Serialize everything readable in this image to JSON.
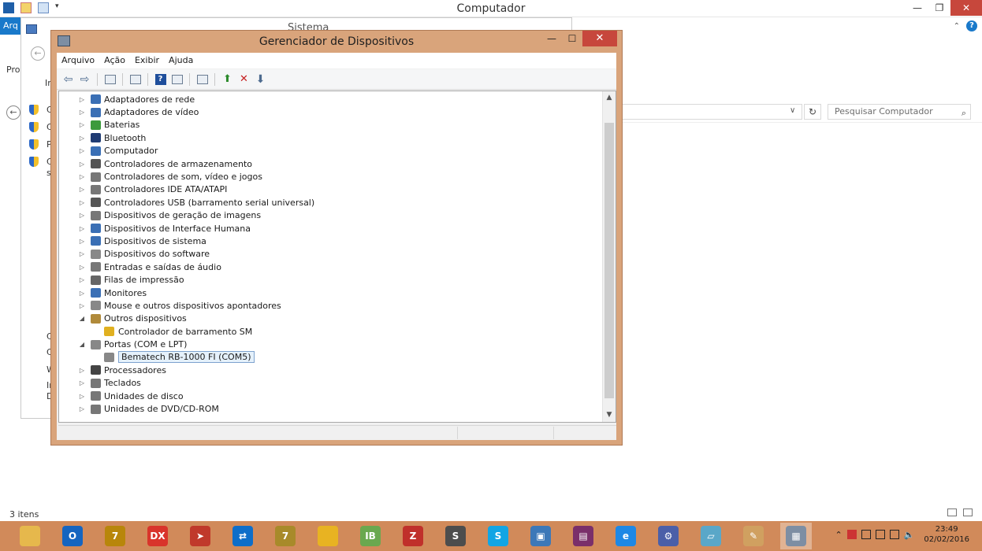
{
  "explorer": {
    "title": "Computador",
    "ribbon_file": "Arq",
    "search_placeholder": "Pesquisar Computador",
    "status": "3 itens",
    "left_labels": [
      "Pro",
      "In"
    ]
  },
  "system_window": {
    "title": "Sistema",
    "sidebar_letters": [
      "G",
      "C",
      "P",
      "C",
      "si"
    ],
    "lower_letters": [
      "C",
      "C",
      "W",
      "In",
      "D"
    ]
  },
  "device_manager": {
    "title": "Gerenciador de Dispositivos",
    "menu": [
      "Arquivo",
      "Ação",
      "Exibir",
      "Ajuda"
    ],
    "tree": [
      {
        "label": "Adaptadores de rede",
        "level": 0,
        "expander": "▷",
        "icon": "network-adapter-icon",
        "color": "#3a6fb5"
      },
      {
        "label": "Adaptadores de vídeo",
        "level": 0,
        "expander": "▷",
        "icon": "display-adapter-icon",
        "color": "#3a6fb5"
      },
      {
        "label": "Baterias",
        "level": 0,
        "expander": "▷",
        "icon": "battery-icon",
        "color": "#3c9a3c"
      },
      {
        "label": "Bluetooth",
        "level": 0,
        "expander": "▷",
        "icon": "bluetooth-icon",
        "color": "#1f3b73"
      },
      {
        "label": "Computador",
        "level": 0,
        "expander": "▷",
        "icon": "computer-icon",
        "color": "#3a6fb5"
      },
      {
        "label": "Controladores de armazenamento",
        "level": 0,
        "expander": "▷",
        "icon": "storage-controller-icon",
        "color": "#555555"
      },
      {
        "label": "Controladores de som, vídeo e jogos",
        "level": 0,
        "expander": "▷",
        "icon": "sound-icon",
        "color": "#777777"
      },
      {
        "label": "Controladores IDE ATA/ATAPI",
        "level": 0,
        "expander": "▷",
        "icon": "ide-icon",
        "color": "#777777"
      },
      {
        "label": "Controladores USB (barramento serial universal)",
        "level": 0,
        "expander": "▷",
        "icon": "usb-icon",
        "color": "#555555"
      },
      {
        "label": "Dispositivos de geração de imagens",
        "level": 0,
        "expander": "▷",
        "icon": "imaging-device-icon",
        "color": "#777777"
      },
      {
        "label": "Dispositivos de Interface Humana",
        "level": 0,
        "expander": "▷",
        "icon": "hid-icon",
        "color": "#3a6fb5"
      },
      {
        "label": "Dispositivos de sistema",
        "level": 0,
        "expander": "▷",
        "icon": "system-device-icon",
        "color": "#3a6fb5"
      },
      {
        "label": "Dispositivos do software",
        "level": 0,
        "expander": "▷",
        "icon": "software-device-icon",
        "color": "#888888"
      },
      {
        "label": "Entradas e saídas de áudio",
        "level": 0,
        "expander": "▷",
        "icon": "audio-io-icon",
        "color": "#777777"
      },
      {
        "label": "Filas de impressão",
        "level": 0,
        "expander": "▷",
        "icon": "printer-icon",
        "color": "#666666"
      },
      {
        "label": "Monitores",
        "level": 0,
        "expander": "▷",
        "icon": "monitor-icon",
        "color": "#3a6fb5"
      },
      {
        "label": "Mouse e outros dispositivos apontadores",
        "level": 0,
        "expander": "▷",
        "icon": "mouse-icon",
        "color": "#888888"
      },
      {
        "label": "Outros dispositivos",
        "level": 0,
        "expander": "◢",
        "icon": "other-devices-icon",
        "color": "#b08a3a"
      },
      {
        "label": "Controlador de barramento SM",
        "level": 1,
        "expander": "",
        "icon": "warning-device-icon",
        "color": "#e0b020"
      },
      {
        "label": "Portas (COM e LPT)",
        "level": 0,
        "expander": "◢",
        "icon": "port-icon",
        "color": "#888888"
      },
      {
        "label": "Bematech RB-1000 FI (COM5)",
        "level": 1,
        "expander": "",
        "icon": "port-icon",
        "color": "#888888",
        "selected": true
      },
      {
        "label": "Processadores",
        "level": 0,
        "expander": "▷",
        "icon": "processor-icon",
        "color": "#444444"
      },
      {
        "label": "Teclados",
        "level": 0,
        "expander": "▷",
        "icon": "keyboard-icon",
        "color": "#777777"
      },
      {
        "label": "Unidades de disco",
        "level": 0,
        "expander": "▷",
        "icon": "disk-drive-icon",
        "color": "#777777"
      },
      {
        "label": "Unidades de DVD/CD-ROM",
        "level": 0,
        "expander": "▷",
        "icon": "dvd-drive-icon",
        "color": "#777777"
      }
    ]
  },
  "taskbar": {
    "apps": [
      {
        "name": "file-explorer-icon",
        "glyph": "",
        "color": "#e6b84c"
      },
      {
        "name": "outlook-icon",
        "glyph": "O",
        "color": "#1565c0"
      },
      {
        "name": "app-7-icon",
        "glyph": "7",
        "color": "#b8860b"
      },
      {
        "name": "dx-icon",
        "glyph": "DX",
        "color": "#d9342b"
      },
      {
        "name": "app-arrow-icon",
        "glyph": "➤",
        "color": "#c0392b"
      },
      {
        "name": "teamviewer-icon",
        "glyph": "⇄",
        "color": "#0e6ec9"
      },
      {
        "name": "app-7-alt-icon",
        "glyph": "7",
        "color": "#a88a2a"
      },
      {
        "name": "chrome-icon",
        "glyph": "",
        "color": "#e8b322"
      },
      {
        "name": "ib-icon",
        "glyph": "IB",
        "color": "#6aa84f"
      },
      {
        "name": "filezilla-icon",
        "glyph": "Z",
        "color": "#c0302b"
      },
      {
        "name": "sublime-icon",
        "glyph": "S",
        "color": "#4d4d4d"
      },
      {
        "name": "skype-icon",
        "glyph": "S",
        "color": "#12a5e4"
      },
      {
        "name": "remote-desktop-icon",
        "glyph": "▣",
        "color": "#3c78b8"
      },
      {
        "name": "winrar-icon",
        "glyph": "▤",
        "color": "#7a2f6a"
      },
      {
        "name": "internet-explorer-icon",
        "glyph": "e",
        "color": "#1e88e5"
      },
      {
        "name": "settings-gear-icon",
        "glyph": "⚙",
        "color": "#4b5fa8"
      },
      {
        "name": "notepad-icon",
        "glyph": "▱",
        "color": "#5aa7c8"
      },
      {
        "name": "paint-icon",
        "glyph": "✎",
        "color": "#d0a060"
      },
      {
        "name": "device-manager-taskbar-icon",
        "glyph": "▦",
        "color": "#7d8ea3"
      }
    ],
    "clock_time": "23:49",
    "clock_date": "02/02/2016"
  }
}
